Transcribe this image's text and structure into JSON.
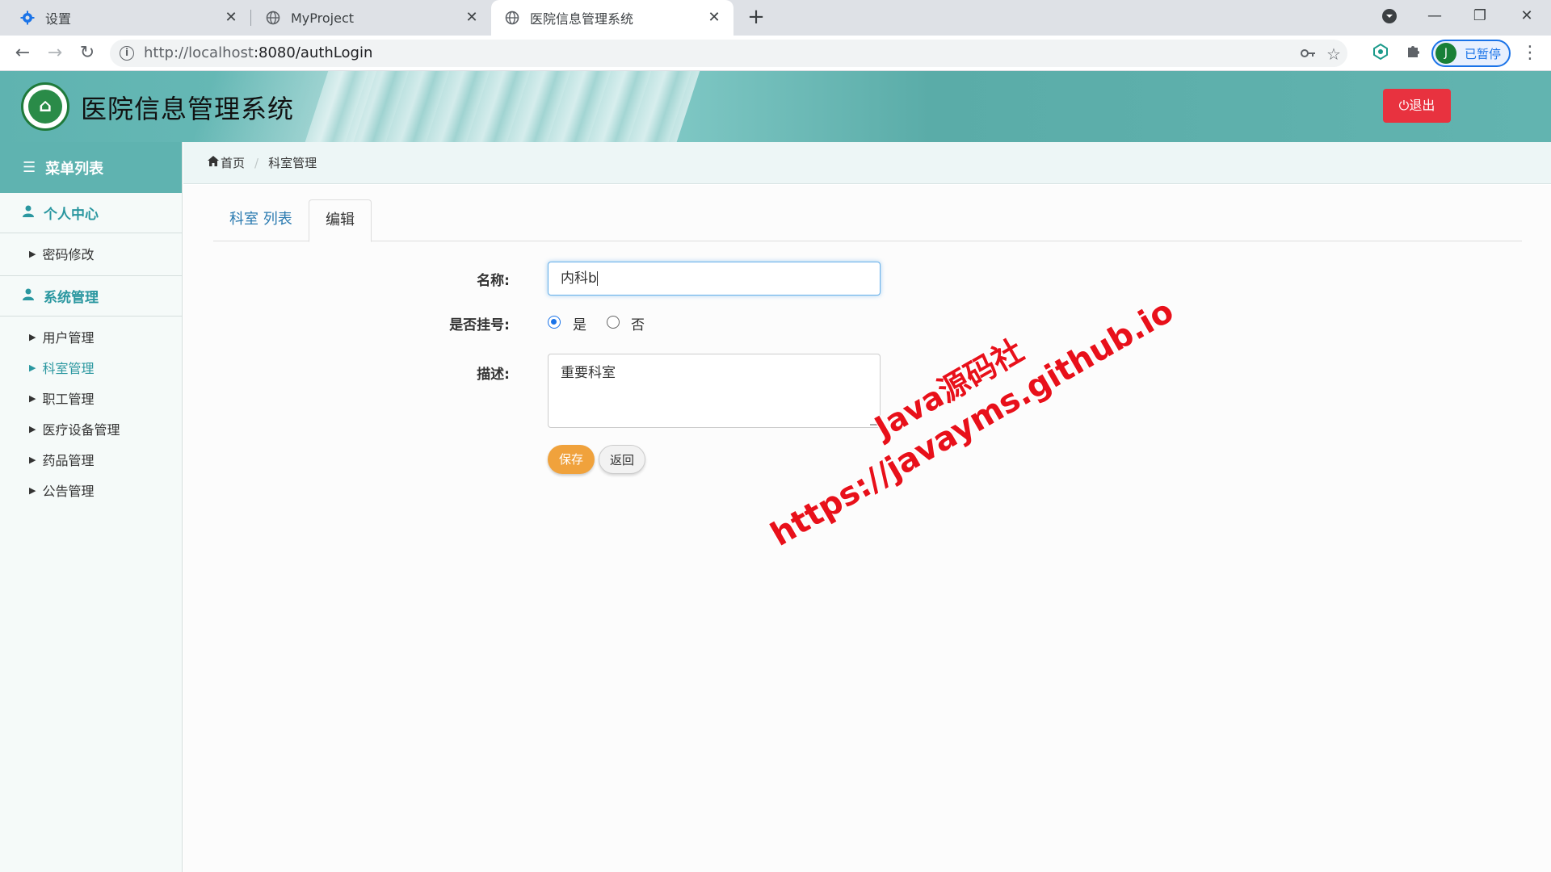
{
  "browser": {
    "tabs": [
      {
        "title": "设置",
        "icon": "gear-icon"
      },
      {
        "title": "MyProject",
        "icon": "globe-icon"
      },
      {
        "title": "医院信息管理系统",
        "icon": "globe-icon"
      }
    ],
    "url_host": "http://localhost",
    "url_path": ":8080/authLogin",
    "profile_initial": "J",
    "profile_label": "已暂停"
  },
  "app": {
    "title": "医院信息管理系统",
    "logout_label": "退出",
    "accent_color": "#5fb3b0",
    "logout_color": "#e8323f"
  },
  "sidebar": {
    "header": "菜单列表",
    "sections": [
      {
        "label": "个人中心",
        "items": [
          {
            "label": "密码修改",
            "active": false
          }
        ]
      },
      {
        "label": "系统管理",
        "items": [
          {
            "label": "用户管理",
            "active": false
          },
          {
            "label": "科室管理",
            "active": true
          },
          {
            "label": "职工管理",
            "active": false
          },
          {
            "label": "医疗设备管理",
            "active": false
          },
          {
            "label": "药品管理",
            "active": false
          },
          {
            "label": "公告管理",
            "active": false
          }
        ]
      }
    ]
  },
  "breadcrumb": {
    "home": "首页",
    "current": "科室管理"
  },
  "page_tabs": [
    {
      "label": "科室 列表",
      "active": false
    },
    {
      "label": "编辑",
      "active": true
    }
  ],
  "form": {
    "name_label": "名称:",
    "name_value": "内科b",
    "register_label": "是否挂号:",
    "register_options": [
      {
        "label": "是",
        "checked": true
      },
      {
        "label": "否",
        "checked": false
      }
    ],
    "desc_label": "描述:",
    "desc_value": "重要科室",
    "save_label": "保存",
    "back_label": "返回"
  },
  "watermark": {
    "line1": "Java源码社",
    "line2": "https://javayms.github.io"
  }
}
